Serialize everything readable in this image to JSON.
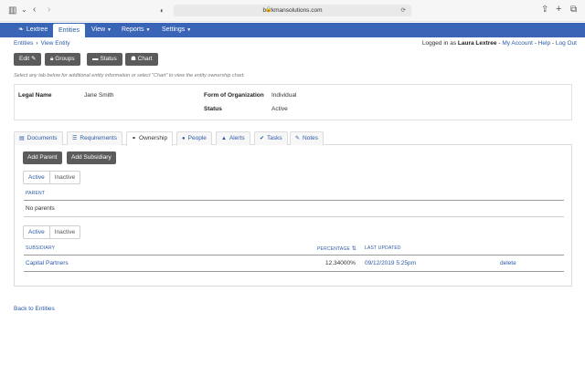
{
  "browser": {
    "url": "berkmansolutions.com"
  },
  "nav": {
    "brand": "Lextree",
    "items": [
      {
        "label": "Entities",
        "active": true
      },
      {
        "label": "View"
      },
      {
        "label": "Reports"
      },
      {
        "label": "Settings"
      }
    ]
  },
  "breadcrumb": [
    "Entities",
    "View Entity"
  ],
  "user": {
    "prefix": "Logged in as",
    "name": "Laura Lextree",
    "links": [
      "My Account",
      "Help",
      "Log Out"
    ]
  },
  "actions": [
    {
      "label": "Edit",
      "icon": "pencil-icon"
    },
    {
      "label": "Groups",
      "icon": "lock-icon"
    },
    {
      "label": "Status",
      "icon": "card-icon"
    },
    {
      "label": "Chart",
      "icon": "sitemap-icon"
    }
  ],
  "hint": "Select any tab below for additional entity information or select \"Chart\" to view the entity ownership chart.",
  "entity": {
    "legal_name_label": "Legal Name",
    "legal_name": "Jane Smith",
    "form_label": "Form of Organization",
    "form": "Individual",
    "status_label": "Status",
    "status": "Active"
  },
  "tabs": [
    {
      "label": "Documents",
      "icon": "documents-icon"
    },
    {
      "label": "Requirements",
      "icon": "list-icon"
    },
    {
      "label": "Ownership",
      "icon": "link-icon",
      "active": true
    },
    {
      "label": "People",
      "icon": "person-icon"
    },
    {
      "label": "Alerts",
      "icon": "bell-icon"
    },
    {
      "label": "Tasks",
      "icon": "check-circle-icon"
    },
    {
      "label": "Notes",
      "icon": "edit-icon"
    }
  ],
  "ownership": {
    "add_parent": "Add Parent",
    "add_subsidiary": "Add Subsidiary",
    "active_label": "Active",
    "inactive_label": "Inactive",
    "parent_header": "PARENT",
    "no_parents": "No parents",
    "subsidiary_header": "SUBSIDIARY",
    "percentage_header": "PERCENTAGE",
    "updated_header": "LAST UPDATED",
    "rows": [
      {
        "name": "Capital Partners",
        "percentage": "12.34000%",
        "updated": "09/12/2019 5:25pm",
        "action": "delete"
      }
    ]
  },
  "back_link": "Back to Entities"
}
